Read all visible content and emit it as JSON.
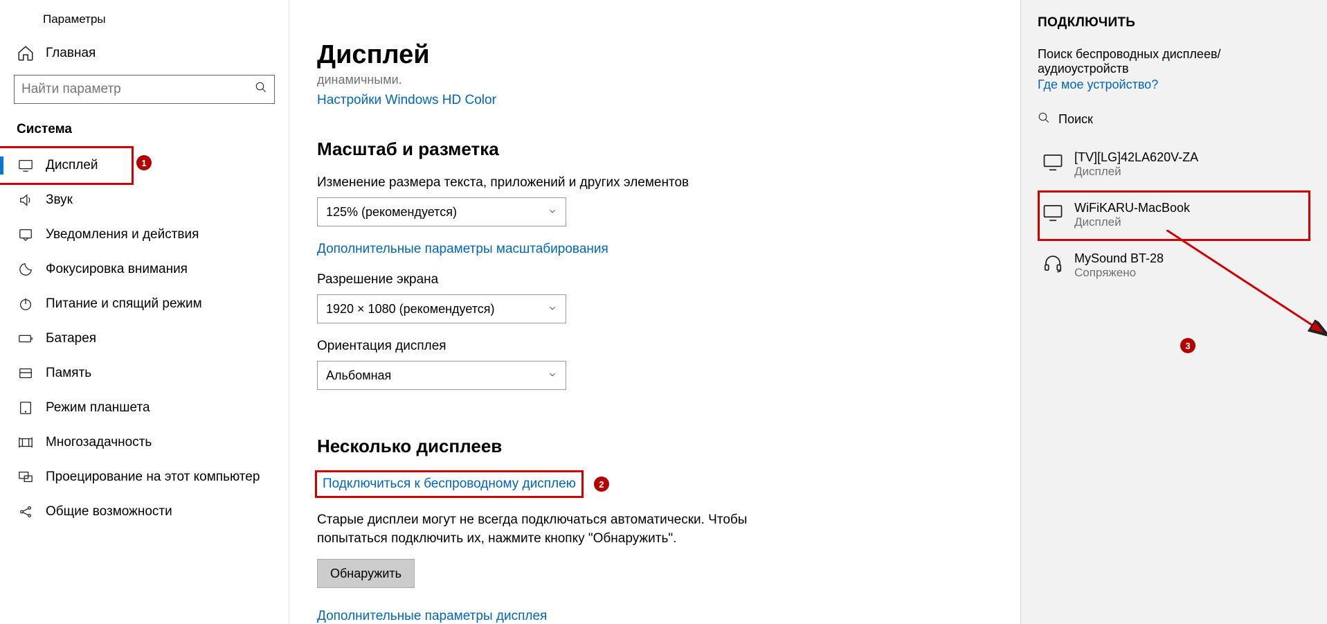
{
  "app": {
    "title": "Параметры"
  },
  "sidebar": {
    "home_label": "Главная",
    "search_placeholder": "Найти параметр",
    "section": "Система",
    "items": [
      {
        "id": "display",
        "label": "Дисплей",
        "active": true,
        "highlight": true
      },
      {
        "id": "sound",
        "label": "Звук"
      },
      {
        "id": "notify",
        "label": "Уведомления и действия"
      },
      {
        "id": "focus",
        "label": "Фокусировка внимания"
      },
      {
        "id": "power",
        "label": "Питание и спящий режим"
      },
      {
        "id": "battery",
        "label": "Батарея"
      },
      {
        "id": "memory",
        "label": "Память"
      },
      {
        "id": "tablet",
        "label": "Режим планшета"
      },
      {
        "id": "multi",
        "label": "Многозадачность"
      },
      {
        "id": "project",
        "label": "Проецирование на этот компьютер"
      },
      {
        "id": "shared",
        "label": "Общие возможности"
      }
    ]
  },
  "main": {
    "title": "Дисплей",
    "subtitle_fragment": "динамичными.",
    "link_hdcolor": "Настройки Windows HD Color",
    "scale_heading": "Масштаб и разметка",
    "scale_label": "Изменение размера текста, приложений и других элементов",
    "scale_value": "125% (рекомендуется)",
    "scale_extra_link": "Дополнительные параметры масштабирования",
    "resolution_label": "Разрешение экрана",
    "resolution_value": "1920 × 1080 (рекомендуется)",
    "orientation_label": "Ориентация дисплея",
    "orientation_value": "Альбомная",
    "multi_heading": "Несколько дисплеев",
    "connect_link": "Подключиться к беспроводному дисплею",
    "old_displays_text": "Старые дисплеи могут не всегда подключаться автоматически. Чтобы попытаться подключить их, нажмите кнопку \"Обнаружить\".",
    "discover_btn": "Обнаружить",
    "more_display_link": "Дополнительные параметры дисплея"
  },
  "panel": {
    "heading": "ПОДКЛЮЧИТЬ",
    "status": "Поиск беспроводных дисплеев/аудиоустройств",
    "where_link": "Где мое устройство?",
    "search_label": "Поиск",
    "devices": [
      {
        "name": "[TV][LG]42LA620V-ZA",
        "sub": "Дисплей",
        "icon": "monitor",
        "highlight": false
      },
      {
        "name": "WiFiKARU-MacBook",
        "sub": "Дисплей",
        "icon": "monitor",
        "highlight": true
      },
      {
        "name": "MySound BT-28",
        "sub": "Сопряжено",
        "icon": "headset",
        "highlight": false
      }
    ]
  },
  "annotations": {
    "b1": "1",
    "b2": "2",
    "b3": "3"
  }
}
